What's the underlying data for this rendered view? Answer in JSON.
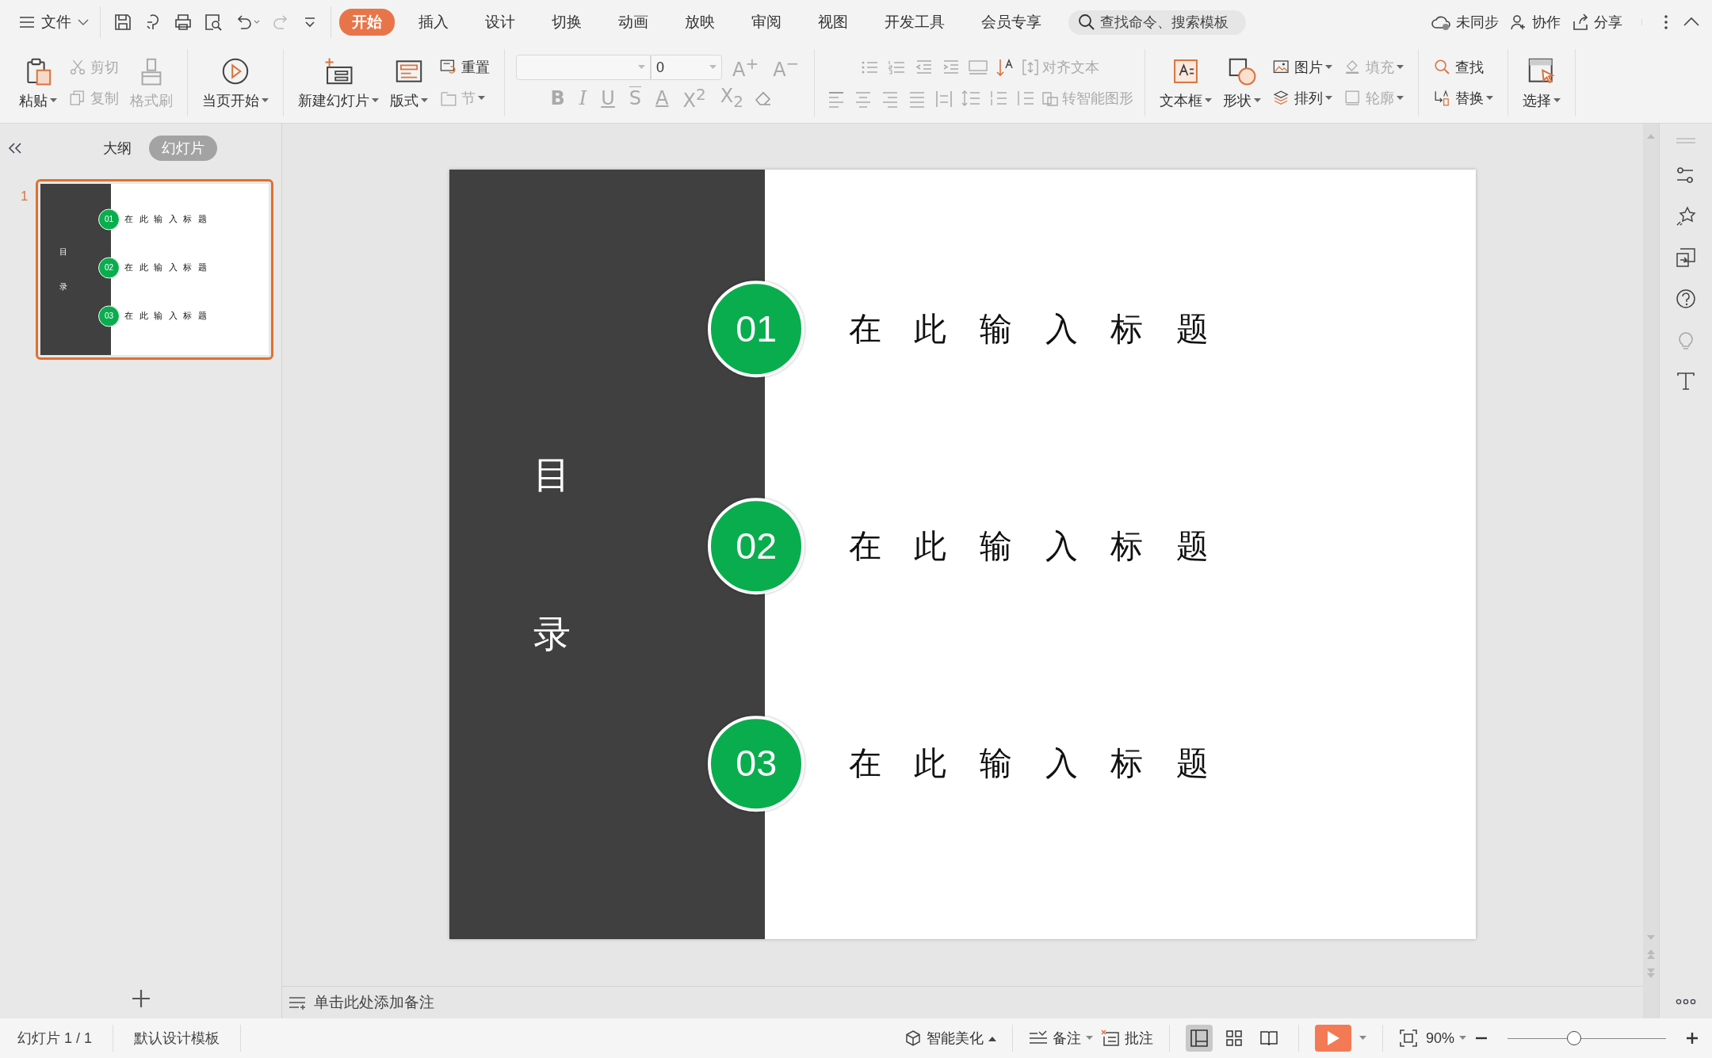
{
  "menu_bar": {
    "file_menu": "文件",
    "tabs": [
      {
        "label": "开始",
        "selected": true
      },
      {
        "label": "插入",
        "selected": false
      },
      {
        "label": "设计",
        "selected": false
      },
      {
        "label": "切换",
        "selected": false
      },
      {
        "label": "动画",
        "selected": false
      },
      {
        "label": "放映",
        "selected": false
      },
      {
        "label": "审阅",
        "selected": false
      },
      {
        "label": "视图",
        "selected": false
      },
      {
        "label": "开发工具",
        "selected": false
      },
      {
        "label": "会员专享",
        "selected": false
      }
    ],
    "search": {
      "placeholder": "查找命令、搜索模板"
    },
    "actions": [
      "未同步",
      "协作",
      "分享"
    ]
  },
  "ribbon": {
    "groups": [
      {
        "kind": "buttons",
        "items": [
          {
            "label": "粘贴",
            "kind": "large",
            "disabled": false,
            "dropdown": true
          },
          {
            "label": "剪切",
            "kind": "small",
            "disabled": true,
            "dropdown": false
          },
          {
            "label": "复制",
            "kind": "small",
            "disabled": true,
            "dropdown": false
          },
          {
            "label": "格式刷",
            "kind": "large",
            "disabled": true,
            "dropdown": false
          }
        ]
      },
      {
        "kind": "buttons",
        "items": [
          {
            "label": "当页开始",
            "kind": "large",
            "disabled": false,
            "dropdown": true
          }
        ]
      },
      {
        "kind": "buttons",
        "items": [
          {
            "label": "新建幻灯片",
            "kind": "large",
            "disabled": false,
            "dropdown": true
          },
          {
            "label": "版式",
            "kind": "large",
            "disabled": false,
            "dropdown": true
          },
          {
            "label": "重置",
            "kind": "small",
            "disabled": false,
            "dropdown": false
          },
          {
            "label": "节",
            "kind": "small",
            "disabled": true,
            "dropdown": true
          }
        ]
      },
      {
        "kind": "font",
        "size": "0",
        "size_buttons": [
          {
            "glyph": "A$^{+}$",
            "disabled": true
          },
          {
            "glyph": "A$^{−}$",
            "disabled": true
          }
        ],
        "format_buttons": [
          {
            "glyph": "B",
            "kind": "bold",
            "disabled": true
          },
          {
            "glyph": "I",
            "kind": "italic",
            "disabled": true
          },
          {
            "glyph": "U",
            "kind": "underline",
            "disabled": true
          },
          {
            "glyph": "S",
            "kind": "strike",
            "disabled": true
          },
          {
            "glyph": "A",
            "kind": "color",
            "disabled": true
          },
          {
            "glyph": "X$^{2}$",
            "kind": "plain",
            "disabled": true
          },
          {
            "glyph": "X$_{2}$",
            "kind": "plain",
            "disabled": true
          }
        ]
      },
      {
        "kind": "paragraph",
        "items": [
          {
            "label": "对齐文本",
            "disabled": true
          },
          {
            "label": "转智能图形",
            "disabled": true
          }
        ]
      },
      {
        "kind": "buttons",
        "items": [
          {
            "label": "文本框",
            "kind": "large",
            "disabled": false,
            "dropdown": true
          },
          {
            "label": "形状",
            "kind": "large",
            "disabled": false,
            "dropdown": true
          },
          {
            "label": "图片",
            "kind": "small",
            "disabled": false,
            "dropdown": true
          },
          {
            "label": "排列",
            "kind": "small",
            "disabled": false,
            "dropdown": true
          },
          {
            "label": "填充",
            "kind": "small",
            "disabled": true,
            "dropdown": true
          },
          {
            "label": "轮廓",
            "kind": "small",
            "disabled": true,
            "dropdown": true
          }
        ]
      },
      {
        "kind": "buttons",
        "items": [
          {
            "label": "查找",
            "kind": "small",
            "disabled": false,
            "dropdown": false
          },
          {
            "label": "替换",
            "kind": "small",
            "disabled": false,
            "dropdown": true
          }
        ]
      },
      {
        "kind": "buttons",
        "items": [
          {
            "label": "选择",
            "kind": "large",
            "disabled": false,
            "dropdown": true
          }
        ]
      }
    ]
  },
  "panel": {
    "tabs": [
      {
        "label": "大纲",
        "selected": false
      },
      {
        "label": "幻灯片",
        "selected": true
      }
    ],
    "slides": [
      {
        "number": "1",
        "selected": true
      }
    ]
  },
  "thumbnail": {
    "side_title": [
      "目",
      "录"
    ],
    "items": [
      {
        "number": "01",
        "title": "在 此 输 入 标 题"
      },
      {
        "number": "02",
        "title": "在 此 输 入 标 题"
      },
      {
        "number": "03",
        "title": "在 此 输 入 标 题"
      }
    ]
  },
  "slide": {
    "side_title": [
      "目",
      "录"
    ],
    "items": [
      {
        "number": "01",
        "title": "在 此 输 入 标 题"
      },
      {
        "number": "02",
        "title": "在 此 输 入 标 题"
      },
      {
        "number": "03",
        "title": "在 此 输 入 标 题"
      }
    ]
  },
  "notes": {
    "placeholder": "单击此处添加备注"
  },
  "status_bar": {
    "slide_info": "幻灯片 1 / 1",
    "template": "默认设计模板",
    "beautify": "智能美化",
    "notes": "备注",
    "comments": "批注",
    "views": [
      {
        "kind": "normal",
        "selected": true
      },
      {
        "kind": "sorter",
        "selected": false
      },
      {
        "kind": "reading",
        "selected": false
      }
    ],
    "zoom": "90%",
    "zoom_slider": {
      "level": 0.42
    }
  }
}
